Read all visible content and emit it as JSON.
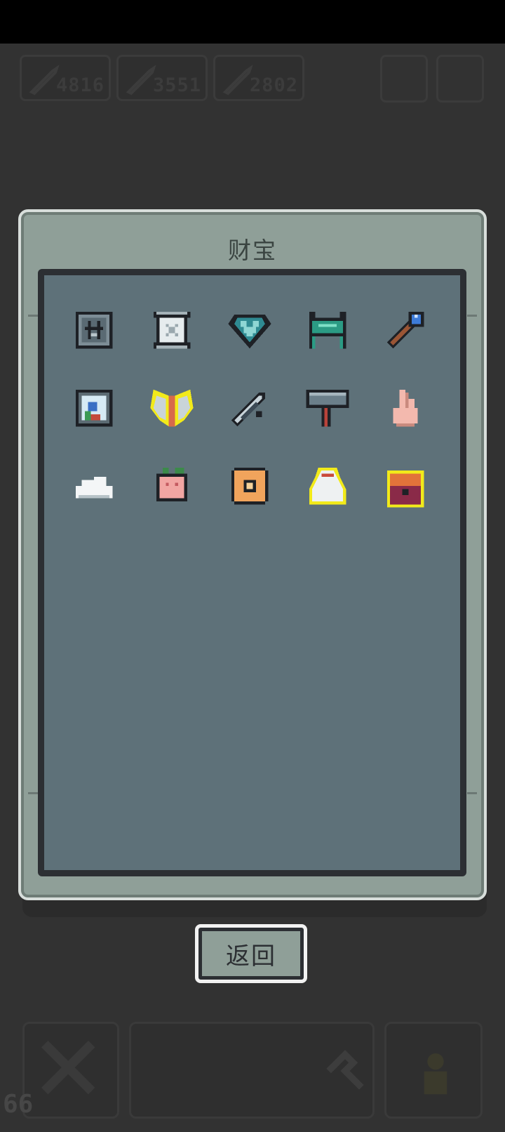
{
  "background_hud": {
    "stats": [
      {
        "value": "4816"
      },
      {
        "value": "3551"
      },
      {
        "value": "2802"
      }
    ],
    "bottom_counter": "66"
  },
  "dialog": {
    "title": "财宝",
    "items": [
      {
        "name": "rune-tablet-icon"
      },
      {
        "name": "scroll-icon"
      },
      {
        "name": "heart-gem-icon"
      },
      {
        "name": "bench-icon"
      },
      {
        "name": "orb-staff-icon"
      },
      {
        "name": "framed-portrait-icon"
      },
      {
        "name": "wings-icon",
        "highlight": "#f2ea1a"
      },
      {
        "name": "sword-icon"
      },
      {
        "name": "hammer-icon"
      },
      {
        "name": "pointing-hand-icon"
      },
      {
        "name": "cloud-icon"
      },
      {
        "name": "peach-icon"
      },
      {
        "name": "cookie-icon"
      },
      {
        "name": "potion-bag-icon",
        "highlight": "#f2ea1a"
      },
      {
        "name": "treasure-chest-icon",
        "highlight": "#f2ea1a"
      }
    ],
    "back_label": "返回"
  },
  "colors": {
    "panel": "#8f9f98",
    "inner": "#5e7179",
    "highlight": "#f2ea1a"
  }
}
